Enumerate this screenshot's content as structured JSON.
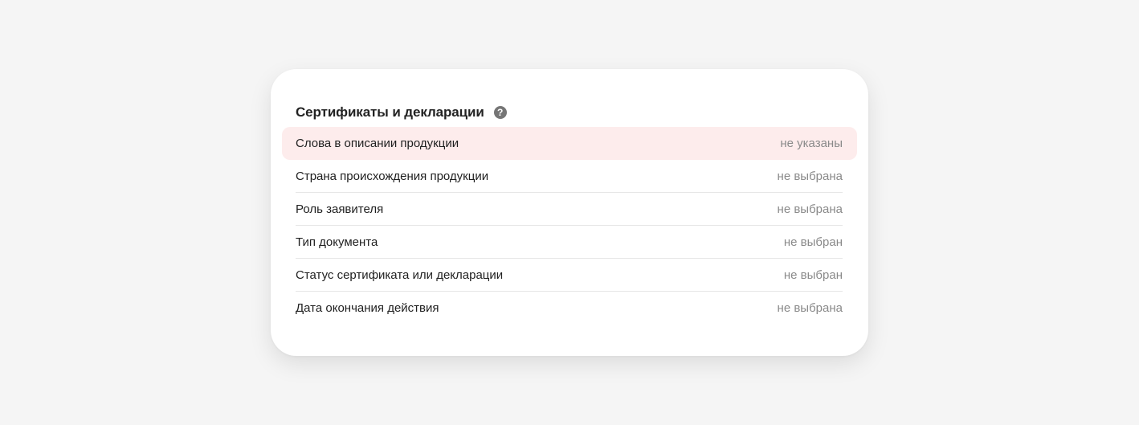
{
  "section": {
    "title": "Сертификаты и декларации",
    "help_icon": "question-circle-icon",
    "rows": [
      {
        "label": "Слова в описании продукции",
        "value": "не указаны",
        "highlighted": true
      },
      {
        "label": "Страна происхождения продукции",
        "value": "не выбрана"
      },
      {
        "label": "Роль заявителя",
        "value": "не выбрана"
      },
      {
        "label": "Тип документа",
        "value": "не выбран"
      },
      {
        "label": "Статус сертификата или декларации",
        "value": "не выбран"
      },
      {
        "label": "Дата окончания действия",
        "value": "не выбрана"
      }
    ]
  },
  "colors": {
    "page_background": "#f5f5f5",
    "card_background": "#ffffff",
    "highlight_background": "#fdecec",
    "value_text": "#8a8a8a",
    "help_icon": "#757575"
  }
}
